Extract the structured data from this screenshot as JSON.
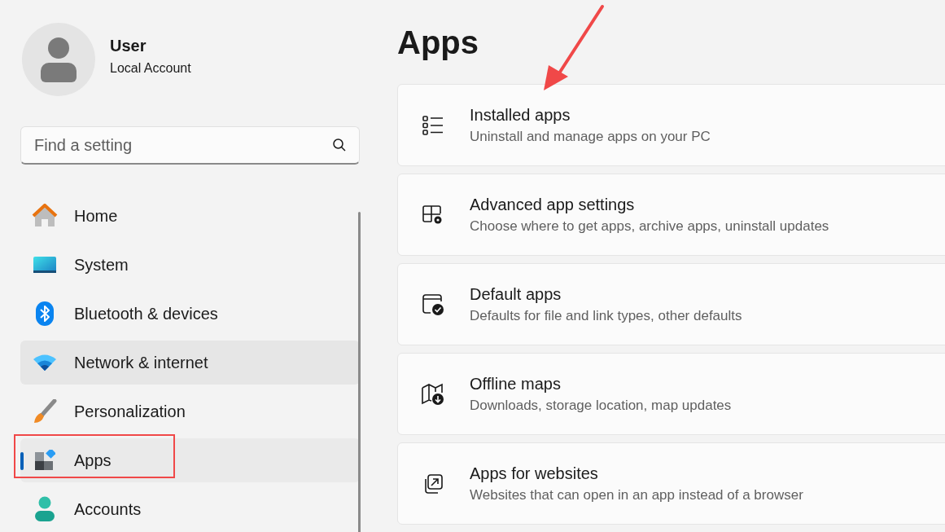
{
  "account": {
    "name": "User",
    "type": "Local Account"
  },
  "search": {
    "placeholder": "Find a setting"
  },
  "sidebar": {
    "items": [
      {
        "label": "Home",
        "selected": false,
        "hovered": false
      },
      {
        "label": "System",
        "selected": false,
        "hovered": false
      },
      {
        "label": "Bluetooth & devices",
        "selected": false,
        "hovered": false
      },
      {
        "label": "Network & internet",
        "selected": false,
        "hovered": true
      },
      {
        "label": "Personalization",
        "selected": false,
        "hovered": false
      },
      {
        "label": "Apps",
        "selected": true,
        "hovered": false
      },
      {
        "label": "Accounts",
        "selected": false,
        "hovered": false
      }
    ]
  },
  "page": {
    "title": "Apps",
    "cards": [
      {
        "title": "Installed apps",
        "description": "Uninstall and manage apps on your PC"
      },
      {
        "title": "Advanced app settings",
        "description": "Choose where to get apps, archive apps, uninstall updates"
      },
      {
        "title": "Default apps",
        "description": "Defaults for file and link types, other defaults"
      },
      {
        "title": "Offline maps",
        "description": "Downloads, storage location, map updates"
      },
      {
        "title": "Apps for websites",
        "description": "Websites that can open in an app instead of a browser"
      }
    ]
  }
}
